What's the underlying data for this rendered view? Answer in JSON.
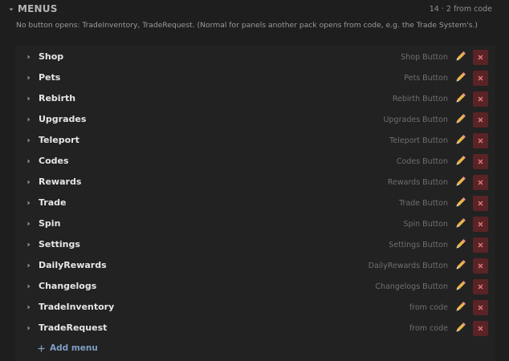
{
  "section": {
    "title": "MENUS",
    "count_text": "14 · 2 from code",
    "notice": "No button opens: TradeInventory, TradeRequest.  (Normal for panels another pack opens from code, e.g. the Trade System's.)"
  },
  "menus": [
    {
      "name": "Shop",
      "binding": "Shop Button"
    },
    {
      "name": "Pets",
      "binding": "Pets Button"
    },
    {
      "name": "Rebirth",
      "binding": "Rebirth Button"
    },
    {
      "name": "Upgrades",
      "binding": "Upgrades Button"
    },
    {
      "name": "Teleport",
      "binding": "Teleport Button"
    },
    {
      "name": "Codes",
      "binding": "Codes Button"
    },
    {
      "name": "Rewards",
      "binding": "Rewards Button"
    },
    {
      "name": "Trade",
      "binding": "Trade Button"
    },
    {
      "name": "Spin",
      "binding": "Spin Button"
    },
    {
      "name": "Settings",
      "binding": "Settings Button"
    },
    {
      "name": "DailyRewards",
      "binding": "DailyRewards Button"
    },
    {
      "name": "Changelogs",
      "binding": "Changelogs Button"
    },
    {
      "name": "TradeInventory",
      "binding": "from code"
    },
    {
      "name": "TradeRequest",
      "binding": "from code"
    }
  ],
  "add_menu_label": "Add menu",
  "icons": {
    "collapse": "chevron-down-icon",
    "row_expand": "chevron-right-icon",
    "edit": "pencil-icon",
    "delete": "close-icon",
    "add": "plus-icon"
  },
  "colors": {
    "background": "#1e1e1e",
    "panel": "#222222",
    "delete_button": "#5a2326",
    "delete_glyph": "#e07a7a",
    "add_link": "#7e9fc4",
    "pencil": "#e8b64a"
  }
}
